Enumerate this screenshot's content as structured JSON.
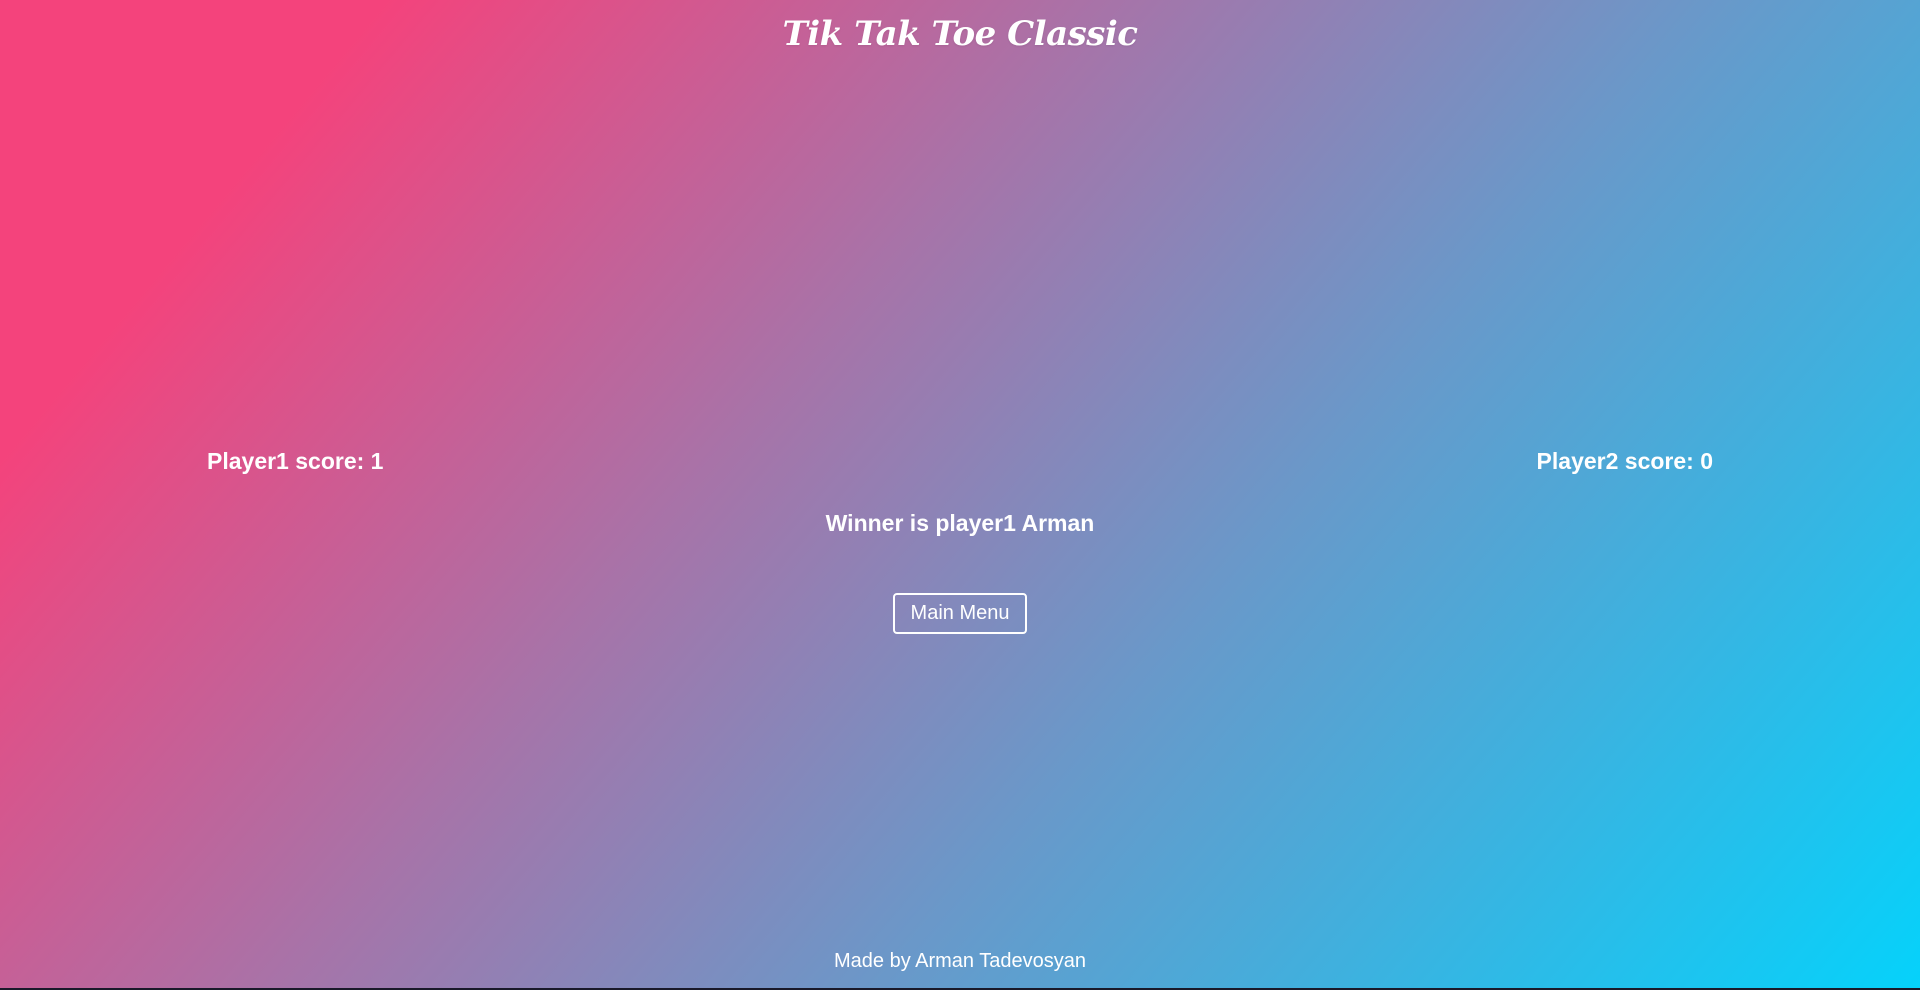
{
  "header": {
    "title": "Tik Tak Toe Classic"
  },
  "scores": {
    "player1": "Player1 score: 1",
    "player2": "Player2 score: 0"
  },
  "result": {
    "winner_text": "Winner is player1 Arman"
  },
  "actions": {
    "main_menu_label": "Main Menu"
  },
  "footer": {
    "credit": "Made by Arman Tadevosyan"
  },
  "colors": {
    "gradient_start": "#f4437c",
    "gradient_end": "#05d2fb",
    "text": "#ffffff"
  }
}
